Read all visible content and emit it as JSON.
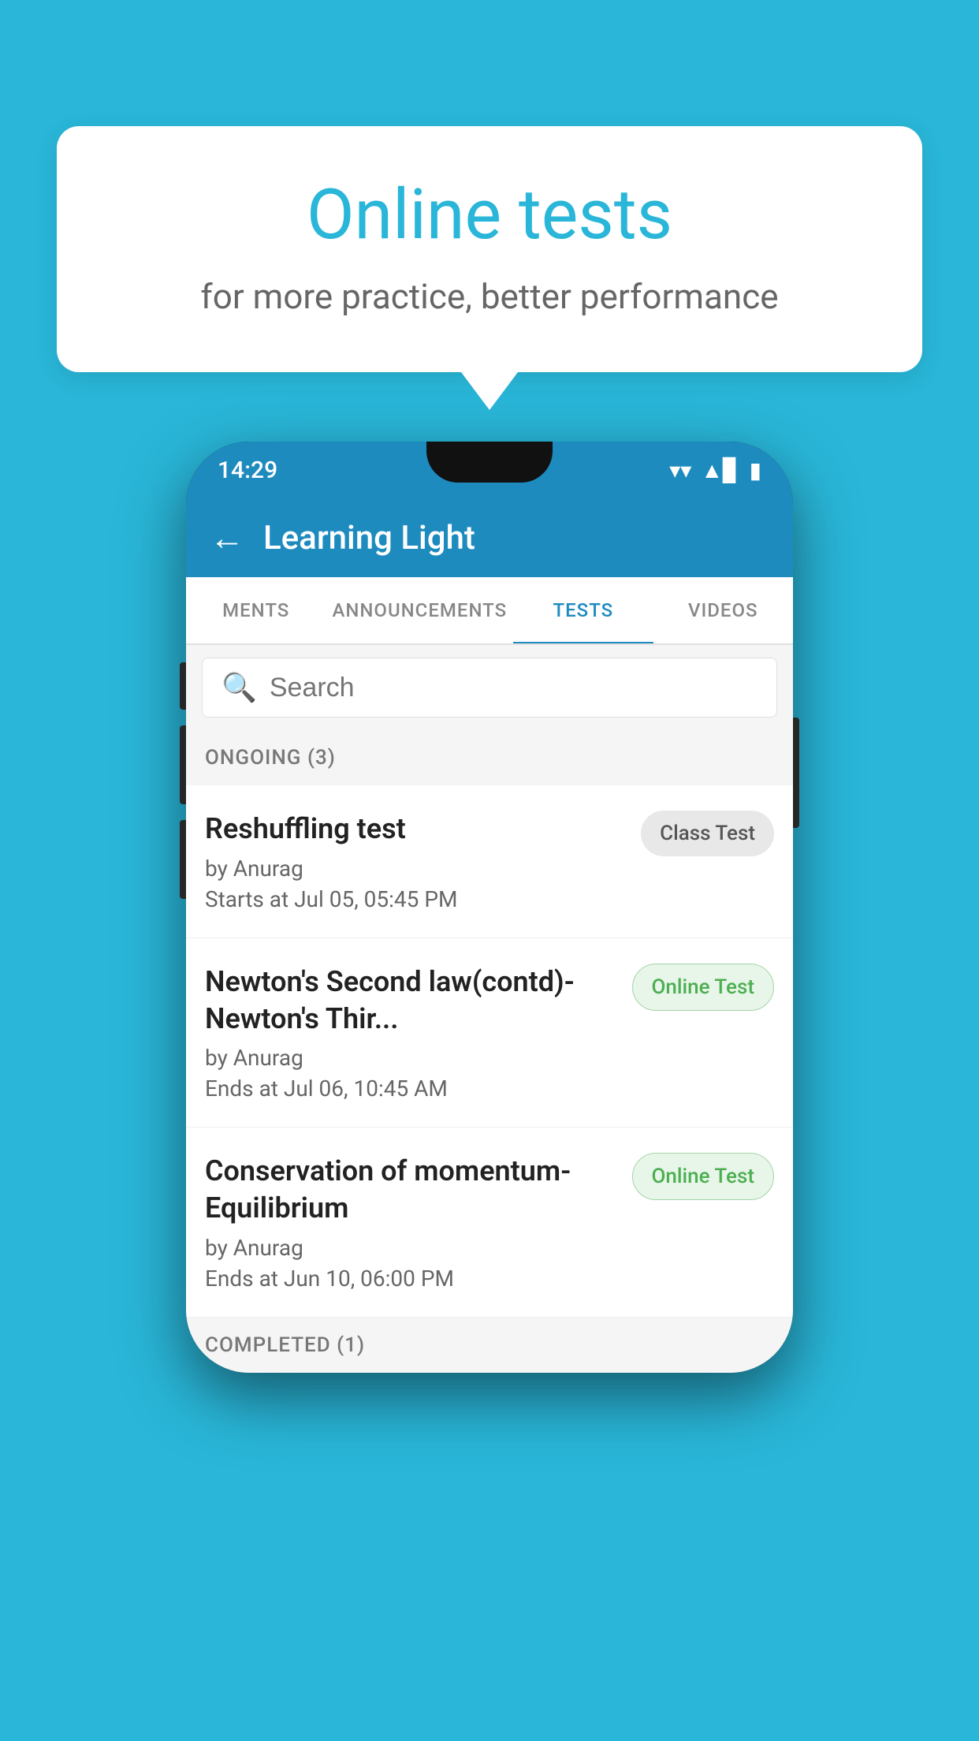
{
  "background_color": "#29b6d8",
  "bubble": {
    "title": "Online tests",
    "subtitle": "for more practice, better performance"
  },
  "status_bar": {
    "time": "14:29",
    "wifi_icon": "▼",
    "signal_icon": "▲",
    "battery_icon": "▮"
  },
  "header": {
    "back_label": "←",
    "title": "Learning Light"
  },
  "tabs": [
    {
      "label": "MENTS",
      "active": false
    },
    {
      "label": "ANNOUNCEMENTS",
      "active": false
    },
    {
      "label": "TESTS",
      "active": true
    },
    {
      "label": "VIDEOS",
      "active": false
    }
  ],
  "search": {
    "placeholder": "Search"
  },
  "ongoing_section": {
    "title": "ONGOING (3)"
  },
  "tests": [
    {
      "name": "Reshuffling test",
      "by": "by Anurag",
      "time_label": "Starts at",
      "time": "Jul 05, 05:45 PM",
      "badge": "Class Test",
      "badge_type": "class"
    },
    {
      "name": "Newton's Second law(contd)-Newton's Thir...",
      "by": "by Anurag",
      "time_label": "Ends at",
      "time": "Jul 06, 10:45 AM",
      "badge": "Online Test",
      "badge_type": "online"
    },
    {
      "name": "Conservation of momentum-Equilibrium",
      "by": "by Anurag",
      "time_label": "Ends at",
      "time": "Jun 10, 06:00 PM",
      "badge": "Online Test",
      "badge_type": "online"
    }
  ],
  "completed_section": {
    "title": "COMPLETED (1)"
  }
}
